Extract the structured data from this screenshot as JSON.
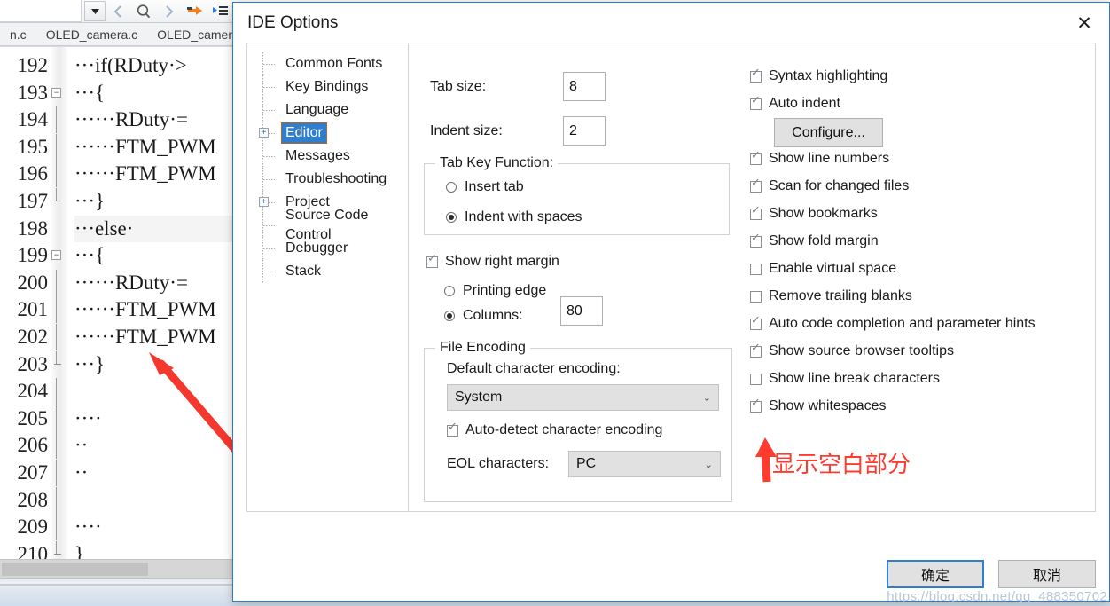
{
  "ide": {
    "tabs": [
      "n.c",
      "OLED_camera.c",
      "OLED_camera.h"
    ],
    "toolbar_icons": [
      "dropdown-arrow-icon",
      "back-arrow-icon",
      "search-icon",
      "forward-arrow-icon",
      "goto-arrow-icon",
      "list-icon"
    ],
    "editor": {
      "lines": [
        {
          "no": "192",
          "text": "···if(RDuty·>",
          "fold": "none",
          "highlight": false
        },
        {
          "no": "193",
          "text": "···{",
          "fold": "minus",
          "highlight": false
        },
        {
          "no": "194",
          "text": "······RDuty·=",
          "fold": "bar",
          "highlight": false
        },
        {
          "no": "195",
          "text": "······FTM_PWM",
          "fold": "bar",
          "highlight": false
        },
        {
          "no": "196",
          "text": "······FTM_PWM",
          "fold": "bar",
          "highlight": false
        },
        {
          "no": "197",
          "text": "···}",
          "fold": "end",
          "highlight": false
        },
        {
          "no": "198",
          "text": "···else·",
          "fold": "none",
          "highlight": true
        },
        {
          "no": "199",
          "text": "···{",
          "fold": "minus",
          "highlight": false
        },
        {
          "no": "200",
          "text": "······RDuty·=",
          "fold": "bar",
          "highlight": false
        },
        {
          "no": "201",
          "text": "······FTM_PWM",
          "fold": "bar",
          "highlight": false
        },
        {
          "no": "202",
          "text": "······FTM_PWM",
          "fold": "bar",
          "highlight": false
        },
        {
          "no": "203",
          "text": "···}",
          "fold": "end",
          "highlight": false
        },
        {
          "no": "204",
          "text": "",
          "fold": "bar",
          "highlight": false
        },
        {
          "no": "205",
          "text": "····",
          "fold": "bar",
          "highlight": false
        },
        {
          "no": "206",
          "text": "··",
          "fold": "bar",
          "highlight": false
        },
        {
          "no": "207",
          "text": "··",
          "fold": "bar",
          "highlight": false
        },
        {
          "no": "208",
          "text": "",
          "fold": "bar",
          "highlight": false
        },
        {
          "no": "209",
          "text": "····",
          "fold": "bar",
          "highlight": false
        },
        {
          "no": "210",
          "text": "}",
          "fold": "end",
          "highlight": false
        }
      ]
    }
  },
  "dialog": {
    "title": "IDE Options",
    "close_label": "✕",
    "tree": [
      {
        "label": "Common Fonts",
        "expandable": false,
        "selected": false
      },
      {
        "label": "Key Bindings",
        "expandable": false,
        "selected": false
      },
      {
        "label": "Language",
        "expandable": false,
        "selected": false
      },
      {
        "label": "Editor",
        "expandable": true,
        "selected": true
      },
      {
        "label": "Messages",
        "expandable": false,
        "selected": false
      },
      {
        "label": "Troubleshooting",
        "expandable": false,
        "selected": false
      },
      {
        "label": "Project",
        "expandable": true,
        "selected": false
      },
      {
        "label": "Source Code Control",
        "expandable": false,
        "selected": false
      },
      {
        "label": "Debugger",
        "expandable": false,
        "selected": false
      },
      {
        "label": "Stack",
        "expandable": false,
        "selected": false
      }
    ],
    "editor_page": {
      "tab_size_label": "Tab size:",
      "tab_size_value": "8",
      "indent_size_label": "Indent size:",
      "indent_size_value": "2",
      "tab_key_function_legend": "Tab Key Function:",
      "tab_key_options": [
        {
          "label": "Insert tab",
          "selected": false
        },
        {
          "label": "Indent with spaces",
          "selected": true
        }
      ],
      "show_right_margin": {
        "label": "Show right margin",
        "checked": true
      },
      "right_margin_options": [
        {
          "label": "Printing edge",
          "selected": false
        },
        {
          "label": "Columns:",
          "selected": true
        }
      ],
      "columns_value": "80",
      "file_encoding_legend": "File Encoding",
      "default_encoding_label": "Default character encoding:",
      "default_encoding_value": "System",
      "auto_detect": {
        "label": "Auto-detect character encoding",
        "checked": true
      },
      "eol_label": "EOL characters:",
      "eol_value": "PC",
      "checkboxes": [
        {
          "label": "Syntax highlighting",
          "checked": true
        },
        {
          "label": "Auto indent",
          "checked": true
        },
        {
          "label": "Show line numbers",
          "checked": true
        },
        {
          "label": "Scan for changed files",
          "checked": true
        },
        {
          "label": "Show bookmarks",
          "checked": true
        },
        {
          "label": "Show fold margin",
          "checked": true
        },
        {
          "label": "Enable virtual space",
          "checked": false
        },
        {
          "label": "Remove trailing blanks",
          "checked": false
        },
        {
          "label": "Auto code completion and parameter hints",
          "checked": true
        },
        {
          "label": "Show source browser tooltips",
          "checked": true
        },
        {
          "label": "Show line break characters",
          "checked": false
        },
        {
          "label": "Show whitespaces",
          "checked": true
        }
      ],
      "configure_button": "Configure..."
    },
    "footer": {
      "ok_label": "确定",
      "cancel_label": "取消"
    }
  },
  "annotations": {
    "whitespace_note": "显示空白部分",
    "arrow_color": "#f4382e"
  },
  "watermark": "https://blog.csdn.net/qq_488350702",
  "colors": {
    "accent_blue": "#2f7fd1",
    "selection_blue": "#2f7fd1",
    "annotation_red": "#ff3b30",
    "dialog_border": "#2a7bd4"
  }
}
